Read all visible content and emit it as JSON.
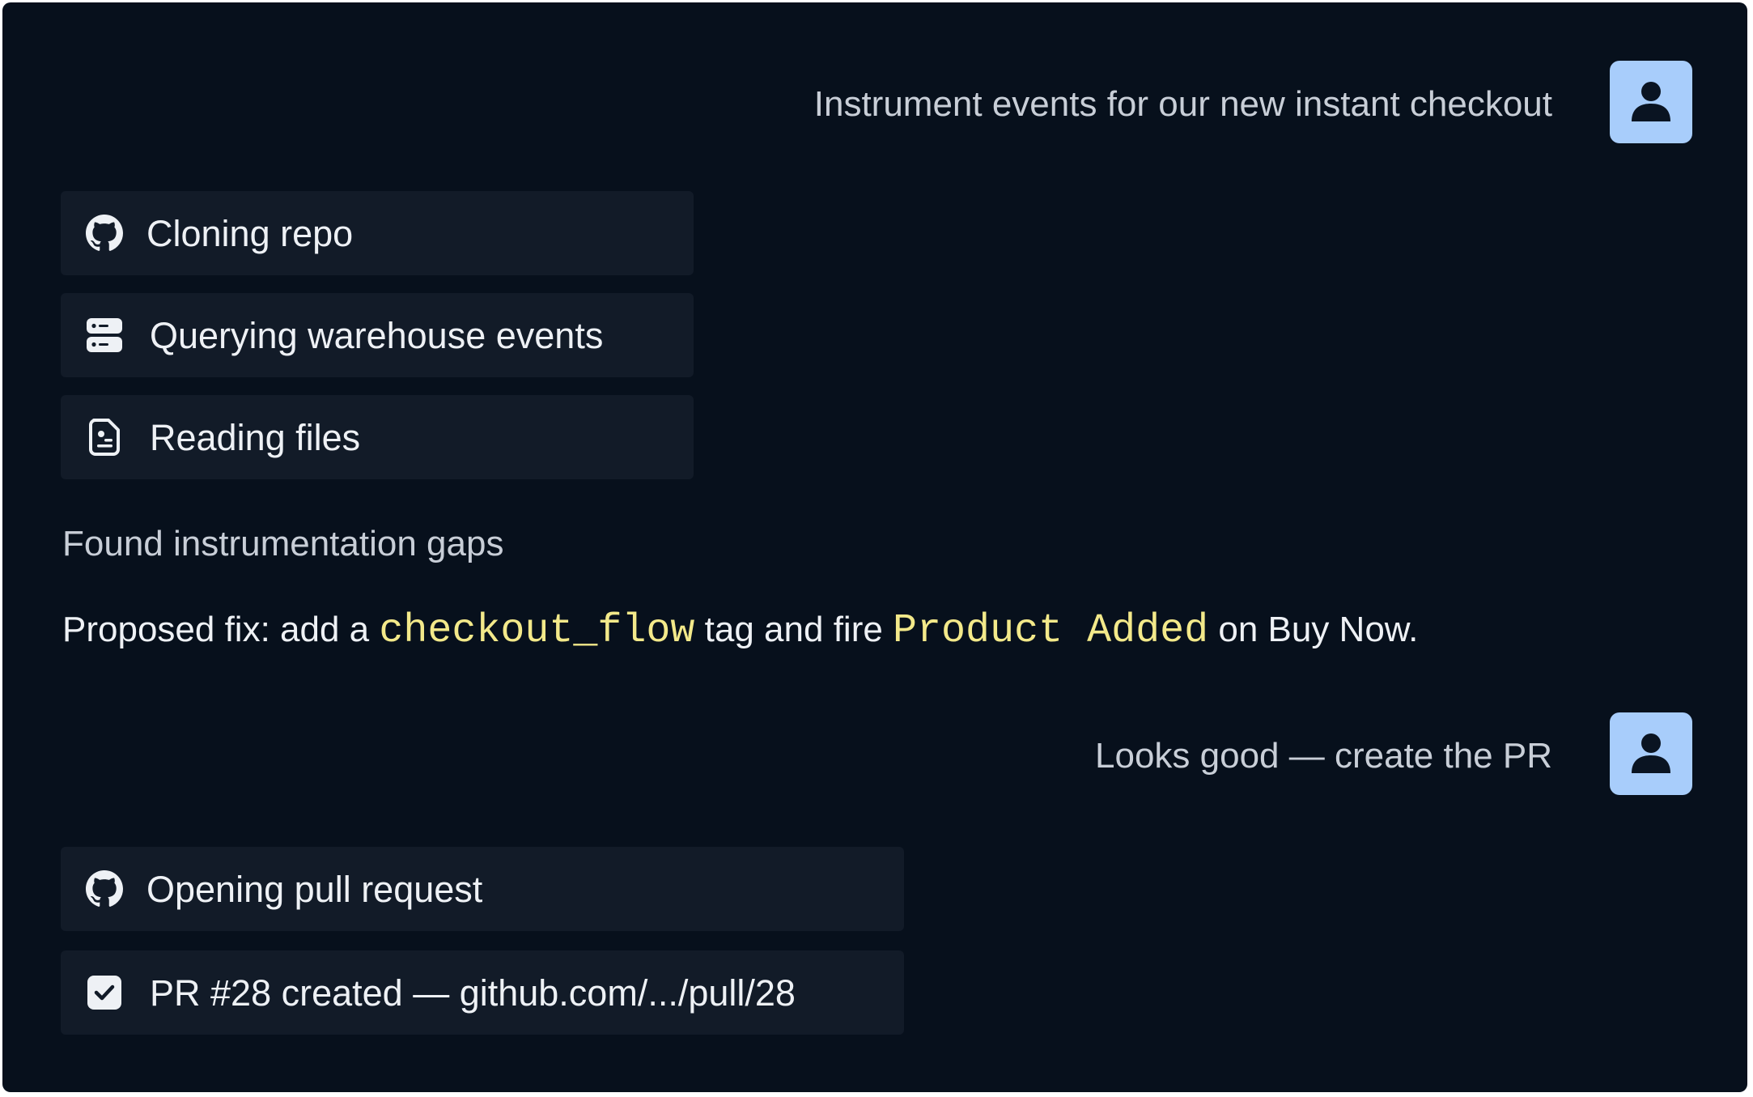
{
  "conversation": {
    "user_message_1": "Instrument events for our new instant checkout",
    "steps_1": [
      {
        "icon": "github-icon",
        "label": "Cloning repo"
      },
      {
        "icon": "database-icon",
        "label": "Querying warehouse events"
      },
      {
        "icon": "file-icon",
        "label": "Reading files"
      }
    ],
    "finding": "Found instrumentation gaps",
    "proposal": {
      "prefix": "Proposed fix: add a ",
      "code_1": "checkout_flow",
      "middle": " tag and fire ",
      "code_2": "Product Added",
      "suffix": " on Buy Now."
    },
    "user_message_2": "Looks good — create the PR",
    "steps_2": [
      {
        "icon": "github-icon",
        "label": "Opening pull request"
      },
      {
        "icon": "checkbox-checked-icon",
        "label": "PR #28 created — github.com/.../pull/28"
      }
    ]
  },
  "colors": {
    "background": "#07101c",
    "card": "#121b28",
    "avatar": "#a8cdfb",
    "code": "#f3e98a"
  }
}
